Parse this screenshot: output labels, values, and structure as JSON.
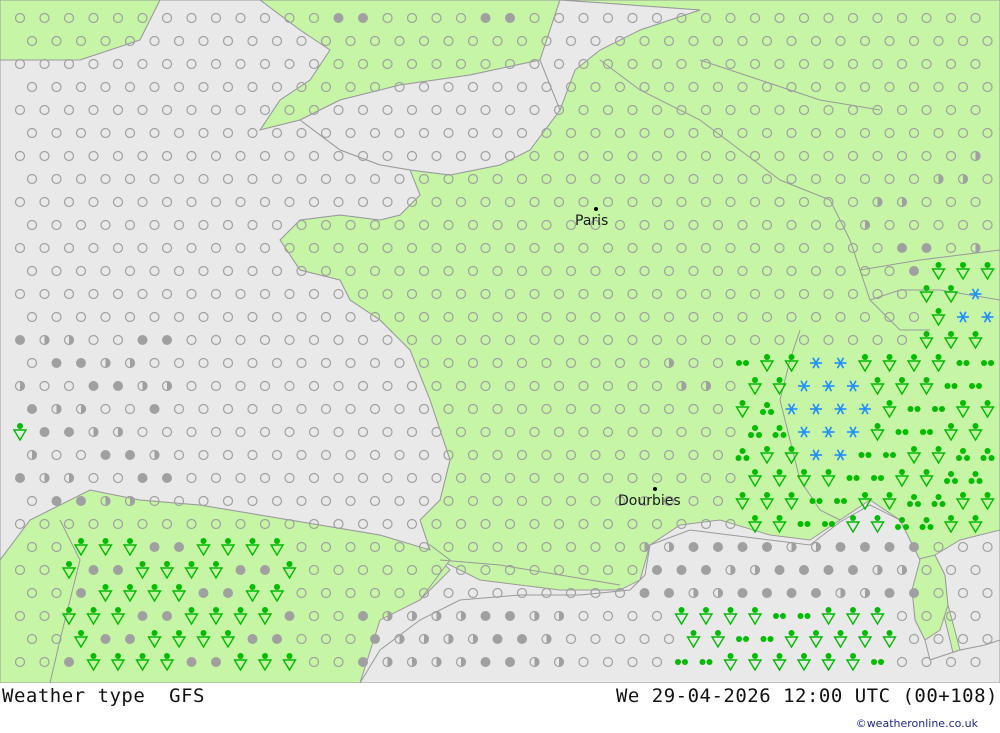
{
  "title": {
    "left": "Weather type  GFS",
    "right": "We 29-04-2026 12:00 UTC (00+108)"
  },
  "credit": "©weatheronline.co.uk",
  "cities": [
    {
      "name": "Paris"
    },
    {
      "name": "Dourbies"
    }
  ],
  "colors": {
    "sea": "#e9e9e9",
    "land": "#c6f5a6",
    "border": "#9a9a9a",
    "dry_symbol": "#a0a0a0",
    "rain_symbol": "#00bb00",
    "snow_symbol": "#1e90ff"
  },
  "legend_symbols": [
    "open-circle-icon",
    "half-circle-icon",
    "filled-circle-icon",
    "shower-icon",
    "rain-dots-icon",
    "snow-icon"
  ]
}
